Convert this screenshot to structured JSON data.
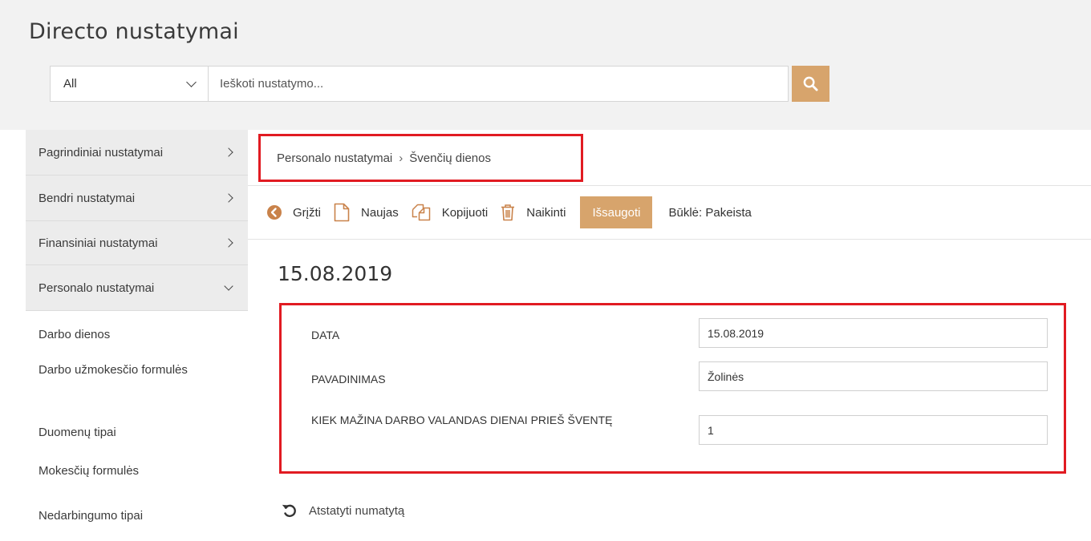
{
  "app": {
    "title": "Directo nustatymai"
  },
  "search": {
    "scope": "All",
    "placeholder": "Ieškoti nustatymo..."
  },
  "sidebar": {
    "items": [
      {
        "label": "Pagrindiniai nustatymai"
      },
      {
        "label": "Bendri nustatymai"
      },
      {
        "label": "Finansiniai nustatymai"
      },
      {
        "label": "Personalo nustatymai"
      }
    ],
    "subitems": [
      {
        "label": "Darbo dienos"
      },
      {
        "label": "Darbo užmokesčio formulės"
      },
      {
        "label": "Duomenų tipai"
      },
      {
        "label": "Mokesčių formulės"
      },
      {
        "label": "Nedarbingumo tipai"
      }
    ]
  },
  "breadcrumb": {
    "parent": "Personalo nustatymai",
    "separator": "›",
    "current": "Švenčių dienos"
  },
  "toolbar": {
    "back": "Grįžti",
    "new": "Naujas",
    "copy": "Kopijuoti",
    "delete": "Naikinti",
    "save": "Išsaugoti",
    "status": "Būklė: Pakeista"
  },
  "record": {
    "title": "15.08.2019"
  },
  "form": {
    "fields": [
      {
        "label": "DATA",
        "value": "15.08.2019"
      },
      {
        "label": "PAVADINIMAS",
        "value": "Žolinės"
      },
      {
        "label": "KIEK MAŽINA DARBO VALANDAS DIENAI PRIEŠ ŠVENTĘ",
        "value": "1"
      }
    ]
  },
  "reset": {
    "label": "Atstatyti numatytą"
  },
  "colors": {
    "accent": "#d7a46c",
    "highlight": "#e11b22",
    "sidebar_bg": "#ececec",
    "header_bg": "#f2f2f2"
  }
}
